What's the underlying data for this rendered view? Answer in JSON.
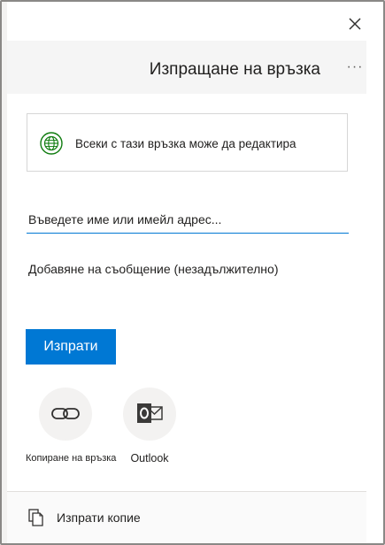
{
  "dialog": {
    "title": "Изпращане на връзка",
    "more_label": "···",
    "permission_text": "Всеки с тази връзка може да редактира",
    "name_placeholder": "Въведете име или имейл адрес...",
    "message_placeholder": "Добавяне на съобщение (незадължително)",
    "send_label": "Изпрати",
    "share_options": [
      {
        "label": "Копиране на връзка",
        "icon": "link-icon"
      },
      {
        "label": "Outlook",
        "icon": "outlook-icon"
      }
    ],
    "footer": {
      "copy_label": "Изпрати копие",
      "icon": "copy-icon"
    }
  },
  "colors": {
    "accent": "#0078d4",
    "globe_green": "#107c10",
    "outlook_dark": "#3b3a39"
  }
}
